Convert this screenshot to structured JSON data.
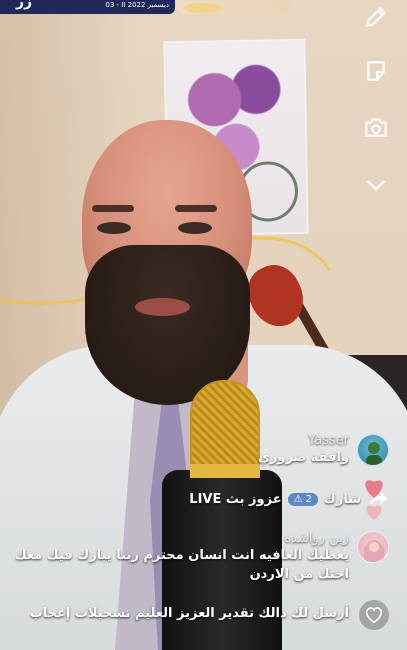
{
  "banner": {
    "text": "03 - II ديسمبر 2022",
    "logo": "زر"
  },
  "toolbar": {
    "icons": [
      "pencil-icon",
      "sticker-icon",
      "flip-camera-icon",
      "chevron-down-icon"
    ]
  },
  "comments": [
    {
      "user": "Yasser",
      "text": "وافقة ضروري"
    },
    {
      "user": "زين رواشده",
      "text_line1": "يعطيك العافيه انت انسان محترم ربنا يبارك فيك معك",
      "text_line2": "اختك من الاردن"
    }
  ],
  "share_row": {
    "label": "شارك",
    "count": "2",
    "live_text": "عزوز بث LIVE"
  },
  "bottom": {
    "text": "أرسل لك ذالك تقدير العزيز العليم تسجيلات إعجاب"
  },
  "colors": {
    "badge": "#5f86c5",
    "banner": "#1f2a5a",
    "share_heart": "#e7707e"
  }
}
